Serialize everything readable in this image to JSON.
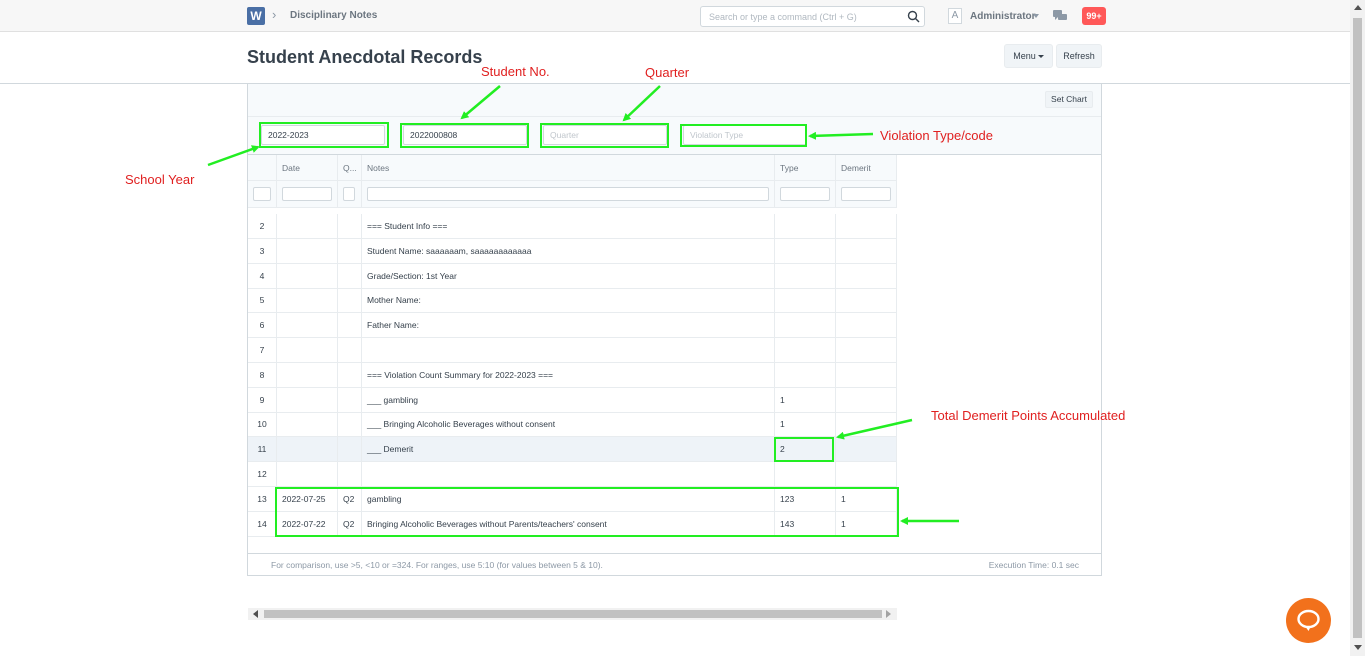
{
  "navbar": {
    "logo_letter": "W",
    "breadcrumb": "Disciplinary Notes",
    "search_placeholder": "Search or type a command (Ctrl + G)",
    "avatar_letter": "A",
    "user": "Administrator",
    "notifications": "99+"
  },
  "page": {
    "title": "Student Anecdotal Records",
    "menu_label": "Menu",
    "refresh_label": "Refresh",
    "set_chart_label": "Set Chart"
  },
  "filters": {
    "school_year": "2022-2023",
    "student_no": "2022000808",
    "quarter_placeholder": "Quarter",
    "violation_placeholder": "Violation Type"
  },
  "table": {
    "columns": [
      "Date",
      "Q...",
      "Notes",
      "Type",
      "Demerit"
    ],
    "rows": [
      {
        "num": "2",
        "date": "",
        "q": "",
        "notes": "=== Student Info ===",
        "type": "",
        "demerit": ""
      },
      {
        "num": "3",
        "date": "",
        "q": "",
        "notes": "Student Name: saaaaaam, saaaaaaaaaaaa",
        "type": "",
        "demerit": ""
      },
      {
        "num": "4",
        "date": "",
        "q": "",
        "notes": "Grade/Section: 1st Year",
        "type": "",
        "demerit": ""
      },
      {
        "num": "5",
        "date": "",
        "q": "",
        "notes": "Mother Name:",
        "type": "",
        "demerit": ""
      },
      {
        "num": "6",
        "date": "",
        "q": "",
        "notes": "Father Name:",
        "type": "",
        "demerit": ""
      },
      {
        "num": "7",
        "date": "",
        "q": "",
        "notes": "",
        "type": "",
        "demerit": ""
      },
      {
        "num": "8",
        "date": "",
        "q": "",
        "notes": "=== Violation Count Summary for 2022-2023 ===",
        "type": "",
        "demerit": ""
      },
      {
        "num": "9",
        "date": "",
        "q": "",
        "notes": "___ gambling",
        "type": "1",
        "demerit": ""
      },
      {
        "num": "10",
        "date": "",
        "q": "",
        "notes": "___ Bringing Alcoholic Beverages without consent",
        "type": "1",
        "demerit": ""
      },
      {
        "num": "11",
        "date": "",
        "q": "",
        "notes": "___ Demerit",
        "type": "2",
        "demerit": ""
      },
      {
        "num": "12",
        "date": "",
        "q": "",
        "notes": "",
        "type": "",
        "demerit": ""
      },
      {
        "num": "13",
        "date": "2022-07-25",
        "q": "Q2",
        "notes": "gambling",
        "type": "123",
        "demerit": "1"
      },
      {
        "num": "14",
        "date": "2022-07-22",
        "q": "Q2",
        "notes": "Bringing Alcoholic Beverages without Parents/teachers' consent",
        "type": "143",
        "demerit": "1"
      }
    ]
  },
  "footer": {
    "hint": "For comparison, use >5, <10 or =324. For ranges, use 5:10 (for values between 5 & 10).",
    "execution_time": "Execution Time: 0.1 sec"
  },
  "annotations": {
    "student_no": "Student No.",
    "quarter": "Quarter",
    "school_year": "School Year",
    "violation_type": "Violation Type/code",
    "total_demerit": "Total Demerit Points Accumulated"
  },
  "colors": {
    "annotation_text": "#e02020",
    "annotation_box": "#22ee22",
    "notification_badge": "#ff5858",
    "chat_bubble": "#f2711c"
  }
}
